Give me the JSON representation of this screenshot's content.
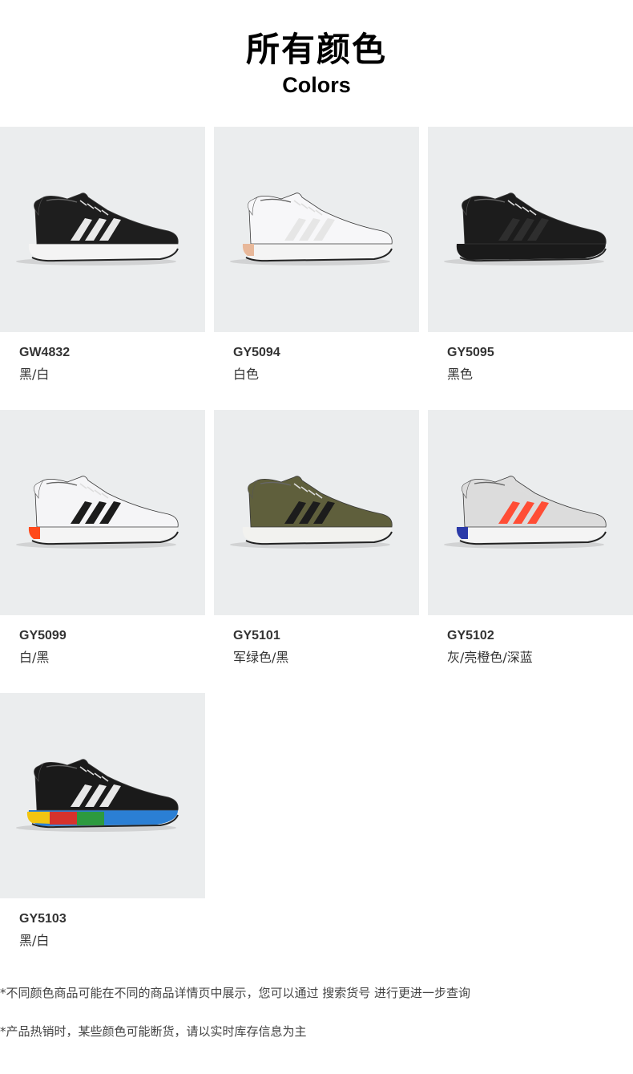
{
  "header": {
    "title_cn": "所有颜色",
    "title_en": "Colors"
  },
  "products": [
    {
      "code": "GW4832",
      "color": "黑/白",
      "upper": "#1e1e1e",
      "stripes": "#e8e8e8",
      "sole": "#f4f4f4",
      "accent": "#ffffff",
      "icon": "black-white-shoe-icon"
    },
    {
      "code": "GY5094",
      "color": "白色",
      "upper": "#f7f7f9",
      "stripes": "#e6e6e6",
      "sole": "#f4f4f4",
      "accent": "#e8b89a",
      "icon": "white-shoe-icon"
    },
    {
      "code": "GY5095",
      "color": "黑色",
      "upper": "#1c1c1c",
      "stripes": "#2e2e2e",
      "sole": "#1a1a1a",
      "accent": "#1a1a1a",
      "icon": "black-shoe-icon"
    },
    {
      "code": "GY5099",
      "color": "白/黑",
      "upper": "#f5f5f7",
      "stripes": "#1c1c1c",
      "sole": "#f4f4f4",
      "accent": "#ff4a1c",
      "icon": "white-black-shoe-icon"
    },
    {
      "code": "GY5101",
      "color": "军绿色/黑",
      "upper": "#5f5f3c",
      "stripes": "#1c1c1c",
      "sole": "#f2f2ef",
      "accent": "#d8d0b8",
      "icon": "olive-black-shoe-icon"
    },
    {
      "code": "GY5102",
      "color": "灰/亮橙色/深蓝",
      "upper": "#dcdcdc",
      "stripes": "#ff4d35",
      "sole": "#f4f4f4",
      "accent": "#2b3aa8",
      "icon": "grey-orange-navy-shoe-icon"
    },
    {
      "code": "GY5103",
      "color": "黑/白",
      "upper": "#1a1a1a",
      "stripes": "#e8e8e8",
      "sole": "#2b7fd4",
      "accent": "#f2c511",
      "icon": "black-white-multicolor-shoe-icon"
    }
  ],
  "notes": [
    "*不同颜色商品可能在不同的商品详情页中展示，您可以通过 搜索货号 进行更进一步查询",
    "*产品热销时，某些颜色可能断货，请以实时库存信息为主"
  ]
}
